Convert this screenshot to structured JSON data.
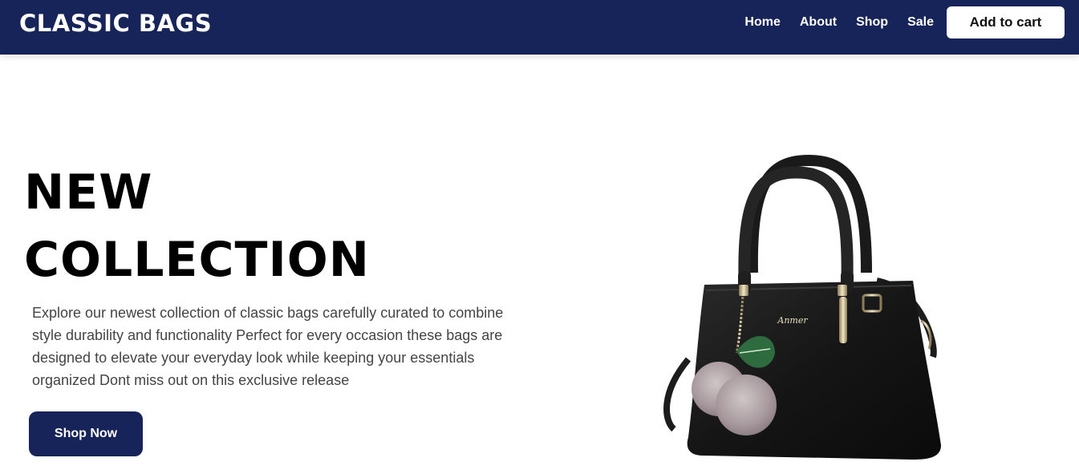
{
  "header": {
    "brand": "CLASSIC BAGS",
    "nav": [
      "Home",
      "About",
      "Shop",
      "Sale"
    ],
    "cart_label": "Add to cart"
  },
  "hero": {
    "title_line1": "NEW",
    "title_line2": "COLLECTION",
    "description": "Explore our newest collection of classic bags carefully curated to combine style durability and functionality Perfect for every occasion these bags are designed to elevate your everyday look while keeping your essentials organized Dont miss out on this exclusive release",
    "cta_label": "Shop Now",
    "bag_logo_text": "Anmer"
  },
  "colors": {
    "navbar": "#17245a",
    "cta": "#17245a",
    "text_dark": "#000000",
    "text_body": "#444444"
  }
}
